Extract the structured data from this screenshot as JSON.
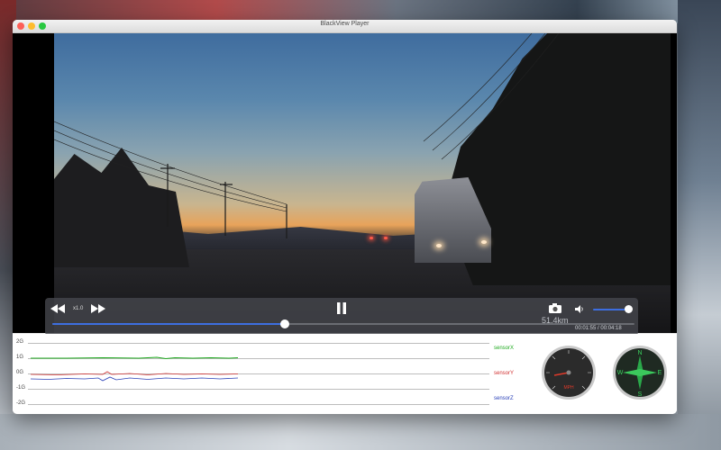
{
  "window": {
    "title": "BlackView Player"
  },
  "playback": {
    "speed_label": "x1.0",
    "distance": "51.4km",
    "time": "00:01:55 / 00:04:18",
    "progress": 0.4,
    "volume": 0.9
  },
  "sensor_chart": {
    "y_ticks": [
      "2G",
      "1G",
      "0G",
      "-1G",
      "-2G"
    ],
    "series": [
      {
        "name": "sensorX",
        "color": "#1faa1f"
      },
      {
        "name": "sensorY",
        "color": "#d03030"
      },
      {
        "name": "sensorZ",
        "color": "#2a40b8"
      }
    ]
  },
  "gauges": {
    "speedometer_unit": "MPH",
    "compass_letters": [
      "N",
      "E",
      "S",
      "W"
    ]
  },
  "colors": {
    "accent": "#3d6ee0"
  }
}
